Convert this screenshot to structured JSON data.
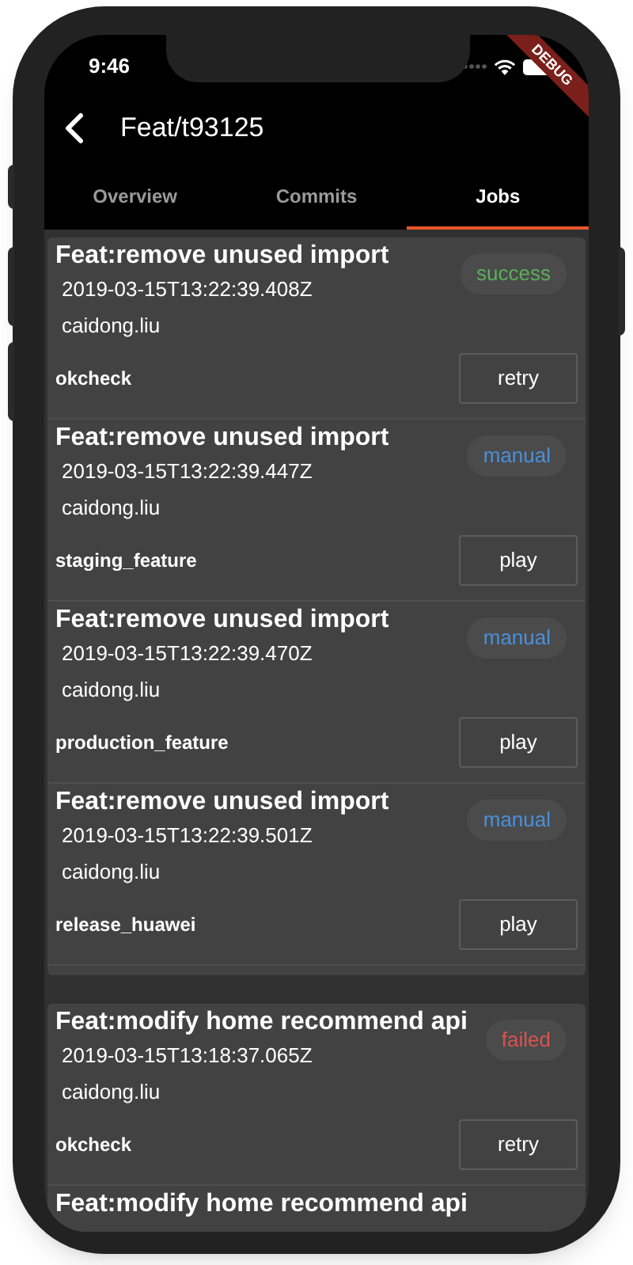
{
  "status_bar": {
    "time": "9:46"
  },
  "debug_banner": "DEBUG",
  "app_bar": {
    "title": "Feat/t93125"
  },
  "tabs": [
    {
      "label": "Overview",
      "selected": false
    },
    {
      "label": "Commits",
      "selected": false
    },
    {
      "label": "Jobs",
      "selected": true
    }
  ],
  "pipelines": [
    {
      "jobs": [
        {
          "title": "Feat:remove unused import",
          "created_at": "2019-03-15T13:22:39.408Z",
          "author": "caidong.liu",
          "status": {
            "label": "success",
            "kind": "success"
          },
          "name": "okcheck",
          "action": "retry"
        },
        {
          "title": "Feat:remove unused import",
          "created_at": "2019-03-15T13:22:39.447Z",
          "author": "caidong.liu",
          "status": {
            "label": "manual",
            "kind": "manual"
          },
          "name": "staging_feature",
          "action": "play"
        },
        {
          "title": "Feat:remove unused import",
          "created_at": "2019-03-15T13:22:39.470Z",
          "author": "caidong.liu",
          "status": {
            "label": "manual",
            "kind": "manual"
          },
          "name": "production_feature",
          "action": "play"
        },
        {
          "title": "Feat:remove unused import",
          "created_at": "2019-03-15T13:22:39.501Z",
          "author": "caidong.liu",
          "status": {
            "label": "manual",
            "kind": "manual"
          },
          "name": "release_huawei",
          "action": "play"
        }
      ]
    },
    {
      "jobs": [
        {
          "title": "Feat:modify home recommend api",
          "created_at": "2019-03-15T13:18:37.065Z",
          "author": "caidong.liu",
          "status": {
            "label": "failed",
            "kind": "failed"
          },
          "name": "okcheck",
          "action": "retry"
        },
        {
          "title": "Feat:modify home recommend api"
        }
      ]
    }
  ]
}
